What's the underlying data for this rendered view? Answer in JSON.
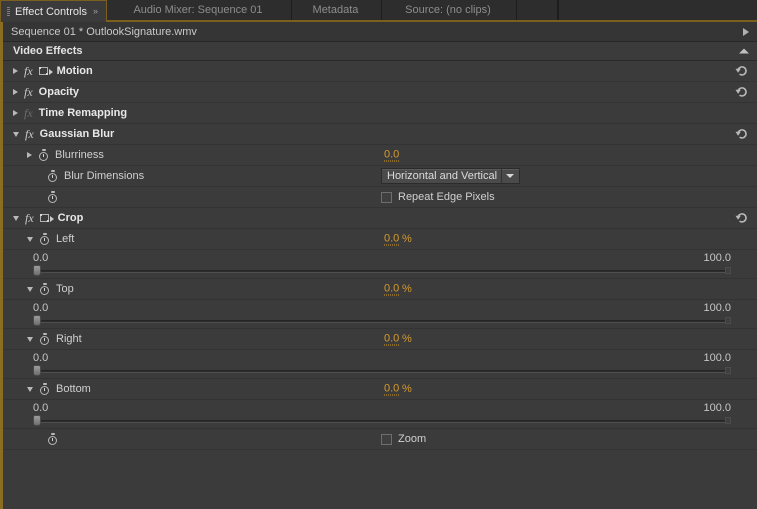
{
  "window": {
    "accent_color": "#7a5f1e",
    "value_color": "#d69a2d",
    "panel_bg": "#3b3b3b"
  },
  "tabs": [
    {
      "label": "Effect Controls",
      "active": true,
      "menu_icon": "panel-menu-icon"
    },
    {
      "label": "Audio Mixer: Sequence 01",
      "active": false
    },
    {
      "label": "Metadata",
      "active": false
    },
    {
      "label": "Source: (no clips)",
      "active": false
    }
  ],
  "sequence_bar": {
    "title": "Sequence 01 * OutlookSignature.wmv",
    "arrow_icon": "play-arrow-icon"
  },
  "video_effects_header": {
    "label": "Video Effects",
    "collapse_icon": "collapse-chevron-icon"
  },
  "effects": [
    {
      "name": "Motion",
      "expanded": false,
      "has_fx": true,
      "has_transform_icon": true,
      "has_reset": true,
      "reset_icon": "reset-arrow-icon"
    },
    {
      "name": "Opacity",
      "expanded": false,
      "has_fx": true,
      "has_transform_icon": false,
      "has_reset": true,
      "reset_icon": "reset-arrow-icon"
    },
    {
      "name": "Time Remapping",
      "expanded": false,
      "has_fx": true,
      "has_transform_icon": false,
      "has_reset": false
    },
    {
      "name": "Gaussian Blur",
      "expanded": true,
      "has_fx": true,
      "has_transform_icon": false,
      "has_reset": true,
      "reset_icon": "reset-arrow-icon",
      "params": [
        {
          "kind": "value",
          "name": "Blurriness",
          "expanded": false,
          "has_triangle": true,
          "value": "0.0",
          "unit": ""
        },
        {
          "kind": "dropdown",
          "name": "Blur Dimensions",
          "has_triangle": false,
          "selected": "Horizontal and Vertical",
          "arrow_icon": "dropdown-arrow-icon"
        },
        {
          "kind": "checkbox",
          "name": "",
          "has_triangle": false,
          "checkbox_label": "Repeat Edge Pixels",
          "checked": false
        }
      ]
    },
    {
      "name": "Crop",
      "expanded": true,
      "has_fx": true,
      "has_transform_icon": true,
      "has_reset": true,
      "reset_icon": "reset-arrow-icon",
      "params": [
        {
          "kind": "slider",
          "name": "Left",
          "expanded": true,
          "has_triangle": true,
          "value": "0.0",
          "unit": "%",
          "slider": {
            "min": "0.0",
            "max": "100.0",
            "position_pct": 0
          }
        },
        {
          "kind": "slider",
          "name": "Top",
          "expanded": true,
          "has_triangle": true,
          "value": "0.0",
          "unit": "%",
          "slider": {
            "min": "0.0",
            "max": "100.0",
            "position_pct": 0
          }
        },
        {
          "kind": "slider",
          "name": "Right",
          "expanded": true,
          "has_triangle": true,
          "value": "0.0",
          "unit": "%",
          "slider": {
            "min": "0.0",
            "max": "100.0",
            "position_pct": 0
          }
        },
        {
          "kind": "slider",
          "name": "Bottom",
          "expanded": true,
          "has_triangle": true,
          "value": "0.0",
          "unit": "%",
          "slider": {
            "min": "0.0",
            "max": "100.0",
            "position_pct": 0
          }
        },
        {
          "kind": "checkbox",
          "name": "",
          "has_triangle": false,
          "checkbox_label": "Zoom",
          "checked": false
        }
      ]
    }
  ]
}
